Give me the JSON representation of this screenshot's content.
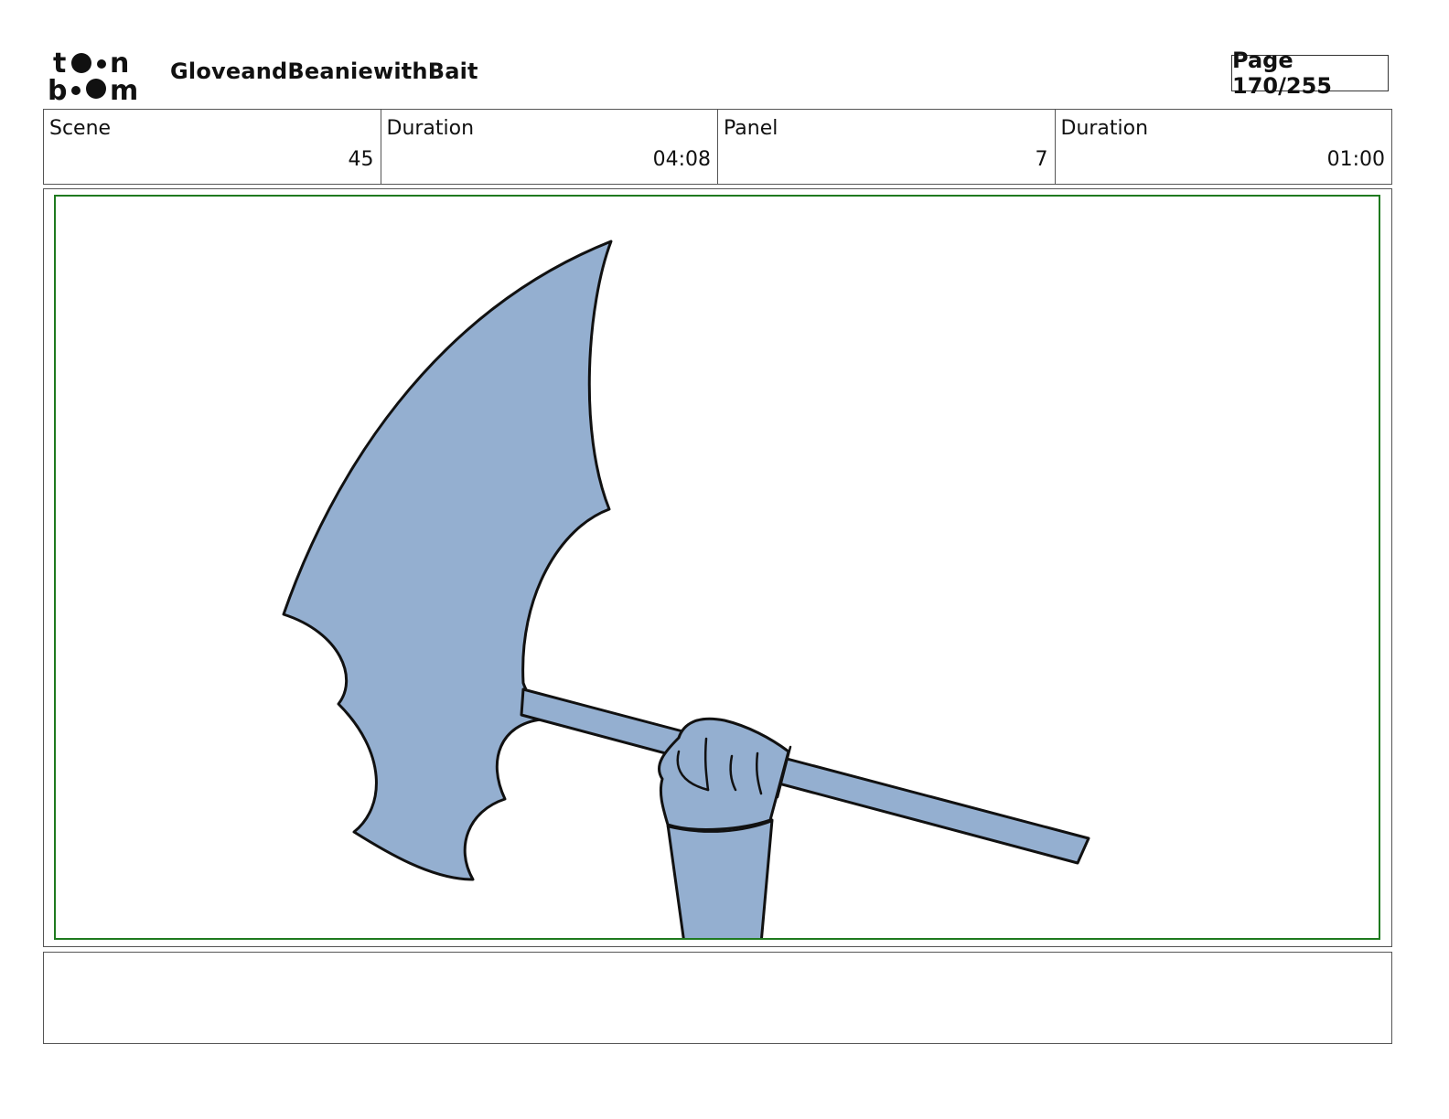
{
  "header": {
    "logo_text": "toon boom",
    "project_title": "GloveandBeaniewithBait",
    "page_label": "Page 170/255"
  },
  "meta": {
    "scene_label": "Scene",
    "scene_value": "45",
    "scene_duration_label": "Duration",
    "scene_duration_value": "04:08",
    "panel_label": "Panel",
    "panel_value": "7",
    "panel_duration_label": "Duration",
    "panel_duration_value": "01:00"
  },
  "panel": {
    "drawing_subject": "hand-raising-battle-axe",
    "fill_color": "#94afd0",
    "line_color": "#111111",
    "frame_color": "#1f7a1f"
  },
  "notes": {
    "text": ""
  }
}
